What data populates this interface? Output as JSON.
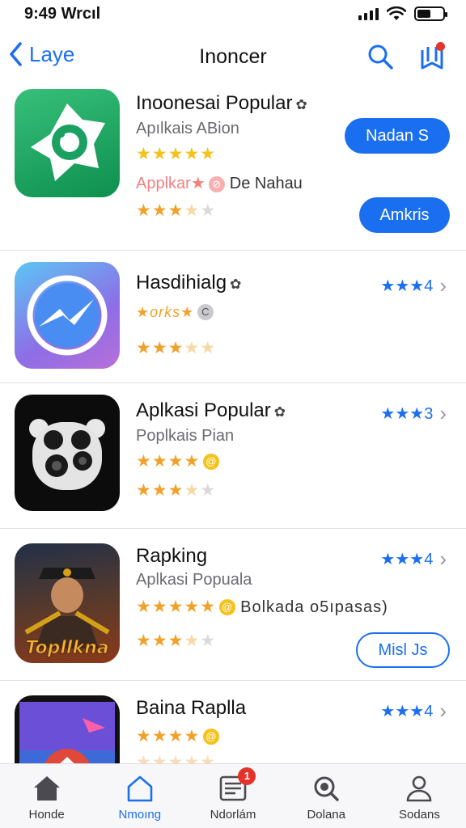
{
  "status": {
    "time": "9:49 Wrcıl"
  },
  "nav": {
    "back_label": "Laye",
    "title": "Inoncer"
  },
  "apps": [
    {
      "name": "Inoonesai Popular",
      "subtitle": "Apılkais ABion",
      "stars_top": "★★★★★",
      "meta_text": "Applkar★",
      "meta_extra": "De Nahau",
      "stars_bottom": "★★★",
      "button1": "Nadan S",
      "button2": "Amkris"
    },
    {
      "name": "Hasdihialg",
      "subtitle": "",
      "stars_top": "★orks★",
      "stars_bottom": "★★★",
      "rating": "★★★4"
    },
    {
      "name": "Aplkasi Popular",
      "subtitle": "Poplkais Pian",
      "stars_top": "★★★★",
      "stars_bottom": "★★★",
      "rating": "★★★3",
      "icon_label": ""
    },
    {
      "name": "Rapking",
      "subtitle": "Aplkasi Popuala",
      "stars_top": "★★★★★",
      "meta_extra": "Bolkada o5ıpasas)",
      "stars_bottom": "★★★",
      "rating": "★★★4",
      "button": "Misl Js",
      "icon_text": "Topllkna"
    },
    {
      "name": "Baina Raplla",
      "subtitle": "",
      "stars_top": "★★★★",
      "rating": "★★★4"
    }
  ],
  "tabs": [
    {
      "label": "Honde",
      "icon": "home-icon"
    },
    {
      "label": "Nmoıng",
      "icon": "house-outline-icon",
      "active": true
    },
    {
      "label": "Ndorlám",
      "icon": "news-icon",
      "badge": "1"
    },
    {
      "label": "Dolana",
      "icon": "search-icon"
    },
    {
      "label": "Sodans",
      "icon": "person-icon"
    }
  ],
  "colors": {
    "accent": "#1a6ff0",
    "badge": "#e5332a",
    "star_orange": "#f1a12a"
  }
}
